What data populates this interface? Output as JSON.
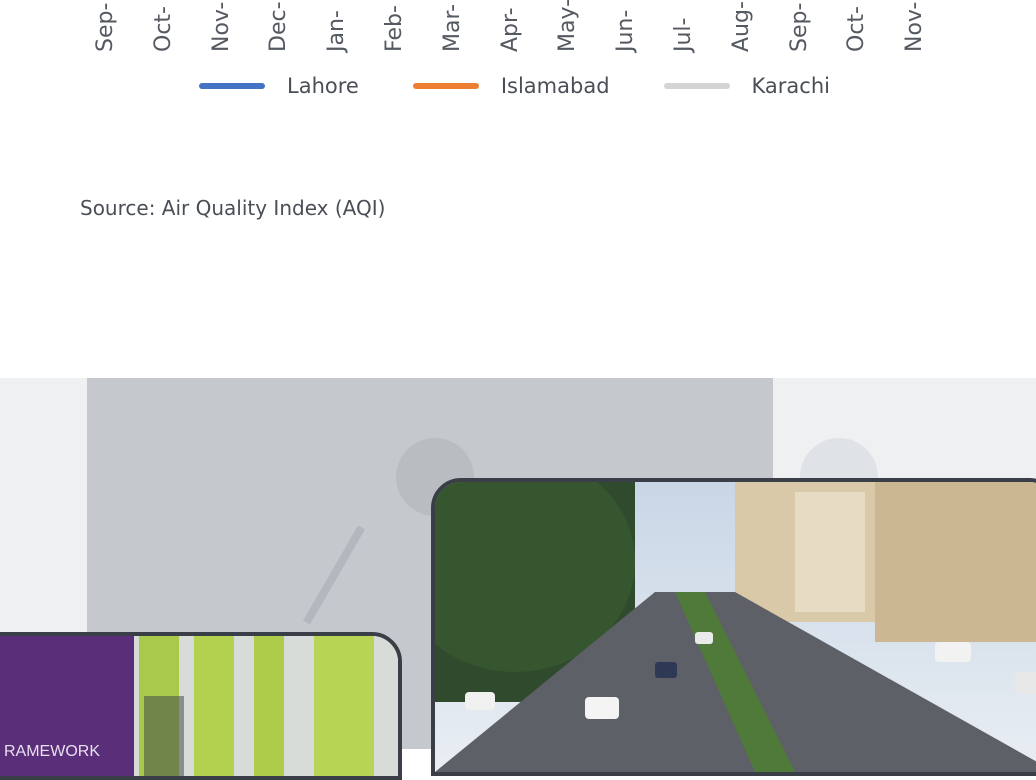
{
  "chart_data": {
    "type": "line",
    "x_tick_labels": [
      "Sep-",
      "Oct-",
      "Nov-",
      "Dec-",
      "Jan-",
      "Feb-",
      "Mar-",
      "Apr-",
      "May-",
      "Jun-",
      "Jul-",
      "Aug-",
      "Sep-",
      "Oct-",
      "Nov-"
    ],
    "series": [
      {
        "name": "Lahore",
        "color": "#4472c4"
      },
      {
        "name": "Islamabad",
        "color": "#ed7d31"
      },
      {
        "name": "Karachi",
        "color": "#d4d4d4"
      }
    ],
    "legend_position": "bottom"
  },
  "source_text": "Source: Air Quality Index (AQI)",
  "gallery": {
    "left_image_caption": "RAMEWORK"
  }
}
